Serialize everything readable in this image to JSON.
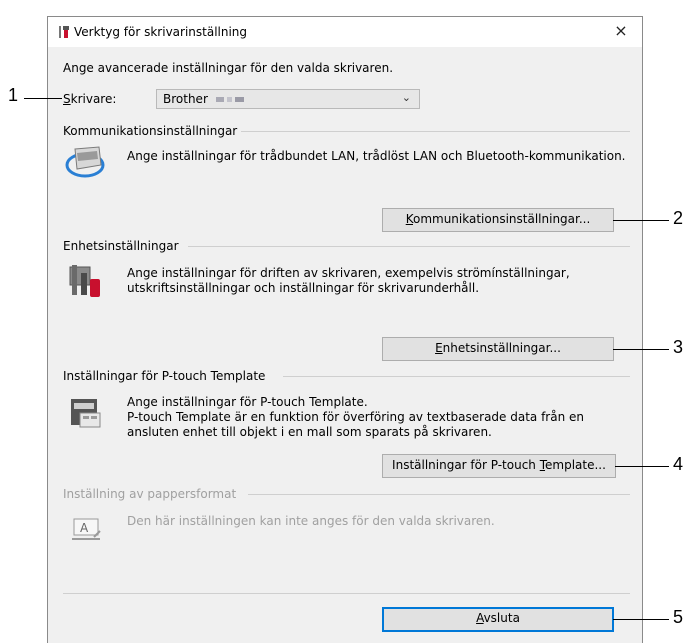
{
  "window": {
    "title": "Verktyg för skrivarinställning",
    "close_symbol": "×",
    "intro": "Ange avancerade inställningar för den valda skrivaren."
  },
  "printer": {
    "label_accel": "S",
    "label_rest": "krivare:",
    "value": "Brother",
    "chevron": "⌄"
  },
  "sections": {
    "communication": {
      "header": "Kommunikationsinställningar",
      "description": "Ange inställningar för trådbundet LAN, trådlöst LAN och Bluetooth-kommunikation.",
      "button_accel": "K",
      "button_rest": "ommunikationsinställningar..."
    },
    "device": {
      "header": "Enhetsinställningar",
      "description_line1": "Ange inställningar för driften av skrivaren, exempelvis strömínställningar,",
      "description_line2": "utskriftsinställningar och inställningar för skrivarunderhåll.",
      "button_accel": "E",
      "button_rest": "nhetsinställningar..."
    },
    "template": {
      "header": "Inställningar för P-touch Template",
      "description_line1": "Ange inställningar för P-touch Template.",
      "description_line2": "P-touch Template är en funktion för överföring av textbaserade data från en",
      "description_line3": "ansluten enhet till objekt i en mall som sparats på skrivaren.",
      "button_pre": "Inställningar för P-touch ",
      "button_accel": "T",
      "button_post": "emplate..."
    },
    "paper": {
      "header": "Inställning av pappersformat",
      "description": "Den här inställningen kan inte anges för den valda skrivaren."
    }
  },
  "exit_button": {
    "accel": "A",
    "rest": "vsluta"
  },
  "callouts": [
    "1",
    "2",
    "3",
    "4",
    "5"
  ],
  "colors": {
    "window_bg": "#f0f0f0",
    "button_bg": "#e1e1e1",
    "focus_border": "#0078d7",
    "disabled_text": "#a0a0a0"
  }
}
